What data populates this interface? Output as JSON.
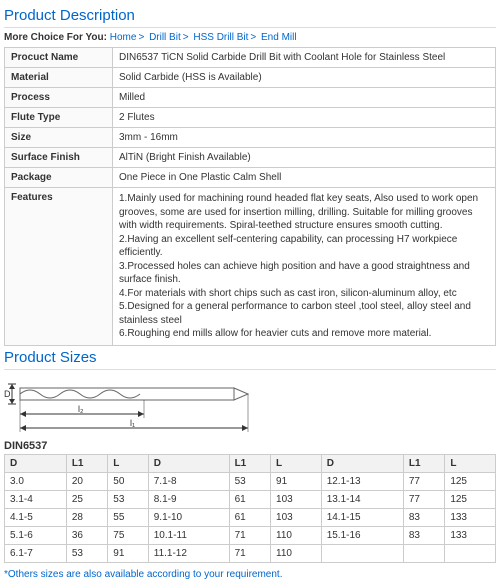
{
  "titles": {
    "desc": "Product Description",
    "sizes": "Product Sizes"
  },
  "more": {
    "label": "More Choice For You:",
    "home": "Home",
    "b1": "Drill Bit",
    "b2": "HSS Drill Bit",
    "b3": "End Mill"
  },
  "spec": {
    "name_l": "Procuct Name",
    "name_v": "DIN6537 TiCN Solid Carbide Drill Bit with Coolant Hole for Stainless Steel",
    "mat_l": "Material",
    "mat_v": "Solid Carbide    (HSS is Available)",
    "proc_l": "Process",
    "proc_v": "Milled",
    "flute_l": "Flute Type",
    "flute_v": "2 Flutes",
    "size_l": "Size",
    "size_v": "3mm - 16mm",
    "surf_l": "Surface Finish",
    "surf_v": "AlTiN    (Bright Finish Available)",
    "pkg_l": "Package",
    "pkg_v": "One Piece in One Plastic Calm Shell",
    "feat_l": "Features",
    "f1": "1.Mainly used for machining round headed flat key seats, Also used to work open grooves, some are used for insertion milling, drilling. Suitable for milling grooves with width requirements. Spiral-teethed structure ensures smooth cutting.",
    "f2": "2.Having an excellent self-centering capability, can processing H7 workpiece efficiently.",
    "f3": "3.Processed holes can achieve high position and have a good straightness and surface finish.",
    "f4": "4.For materials with short chips such as cast iron, silicon-aluminum alloy, etc",
    "f5": "5.Designed for a general performance to carbon steel ,tool steel, alloy steel and stainless steel",
    "f6": "6.Roughing end mills allow for heavier cuts and remove more material."
  },
  "din": "DIN6537",
  "h": {
    "D": "D",
    "L1": "L1",
    "L": "L"
  },
  "r": [
    {
      "a": "3.0",
      "b": "20",
      "c": "50",
      "d": "7.1-8",
      "e": "53",
      "f": "91",
      "g": "12.1-13",
      "h": "77",
      "i": "125"
    },
    {
      "a": "3.1-4",
      "b": "25",
      "c": "53",
      "d": "8.1-9",
      "e": "61",
      "f": "103",
      "g": "13.1-14",
      "h": "77",
      "i": "125"
    },
    {
      "a": "4.1-5",
      "b": "28",
      "c": "55",
      "d": "9.1-10",
      "e": "61",
      "f": "103",
      "g": "14.1-15",
      "h": "83",
      "i": "133"
    },
    {
      "a": "5.1-6",
      "b": "36",
      "c": "75",
      "d": "10.1-11",
      "e": "71",
      "f": "110",
      "g": "15.1-16",
      "h": "83",
      "i": "133"
    },
    {
      "a": "6.1-7",
      "b": "53",
      "c": "91",
      "d": "11.1-12",
      "e": "71",
      "f": "110",
      "g": "",
      "h": "",
      "i": ""
    }
  ],
  "note": "*Others sizes are also available according to your requirement."
}
